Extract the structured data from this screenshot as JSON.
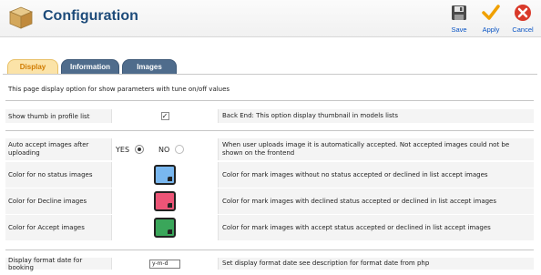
{
  "header": {
    "title": "Configuration",
    "buttons": {
      "save": "Save",
      "apply": "Apply",
      "cancel": "Cancel"
    }
  },
  "colors": {
    "title": "#1d4b7a",
    "tab_active_bg": "#fbe3a8",
    "tab_inactive_bg": "#4f6c8c",
    "link": "#0b55c4"
  },
  "tabs": [
    {
      "label": "Display",
      "active": true
    },
    {
      "label": "Information",
      "active": false
    },
    {
      "label": "Images",
      "active": false
    }
  ],
  "intro": "This page display option for show parameters with tune on/off values",
  "rows": {
    "thumb": {
      "label": "Show thumb in profile list",
      "checked": true,
      "desc": "Back End: This option display thumbnail in models lists"
    },
    "auto_accept": {
      "label": "Auto accept images after uploading",
      "yes": "YES",
      "no": "NO",
      "value": "YES",
      "desc": "When user uploads image it is automatically accepted. Not accepted images could not be shown on the frontend"
    },
    "no_status": {
      "label": "Color for no status images",
      "color": "#79b7ef",
      "desc": "Color for mark images without no status accepted or declined in list accept images"
    },
    "decline": {
      "label": "Color for Decline images",
      "color": "#ec5577",
      "desc": "Color for mark images with declined status accepted or declined in list accept images"
    },
    "accept": {
      "label": "Color for Accept images",
      "color": "#3aa65a",
      "desc": "Color for mark images with accept status accepted or declined in list accept images"
    },
    "date_format": {
      "label": "Display format date for booking",
      "value": "y-m-d",
      "desc": "Set display format date see description for format date from php"
    }
  }
}
